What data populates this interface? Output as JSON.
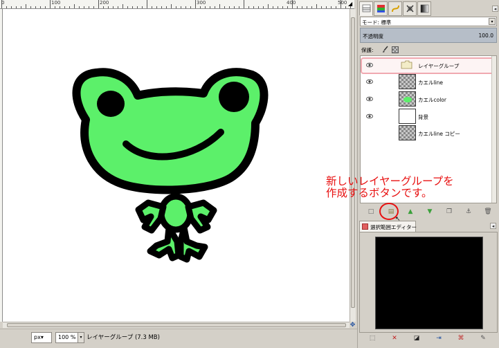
{
  "ruler": {
    "labels": [
      "0",
      "100",
      "200",
      "300",
      "400",
      "500"
    ],
    "corner_icon": "arrow-icon"
  },
  "status": {
    "unit": "px▾",
    "zoom": "100 %",
    "zoom_arrow": "▾",
    "text": "レイヤーグループ (7.3 MB)"
  },
  "dock": {
    "tabs": [
      "layers-icon",
      "channels-icon",
      "paths-icon",
      "undo-icon",
      "gradient-icon"
    ],
    "menu_glyph": "◂",
    "mode_label": "モード: 標準",
    "mode_arrow": "▾",
    "opacity_label": "不透明度",
    "opacity_value": "100.0",
    "lock_label": "保護:"
  },
  "layers": [
    {
      "name": "レイヤーグループ",
      "type": "group",
      "visible": true,
      "selected": true
    },
    {
      "name": "カエルline",
      "type": "checker",
      "visible": true,
      "selected": false
    },
    {
      "name": "カエルcolor",
      "type": "checker",
      "visible": true,
      "selected": false
    },
    {
      "name": "背景",
      "type": "white",
      "visible": true,
      "selected": false
    },
    {
      "name": "カエルline コピー",
      "type": "checker",
      "visible": false,
      "selected": false
    }
  ],
  "layer_buttons": [
    {
      "name": "new-layer-button",
      "glyph": "□"
    },
    {
      "name": "new-layer-group-button",
      "glyph": "▤"
    },
    {
      "name": "raise-layer-button",
      "glyph": "▲"
    },
    {
      "name": "lower-layer-button",
      "glyph": "▼"
    },
    {
      "name": "duplicate-layer-button",
      "glyph": "❐"
    },
    {
      "name": "anchor-layer-button",
      "glyph": "⚓"
    },
    {
      "name": "delete-layer-button",
      "glyph": "🗑"
    }
  ],
  "annotation": {
    "line1": "新しいレイヤーグループを",
    "line2": "作成するボタンです。",
    "color": "#e81010"
  },
  "selection_editor": {
    "title": "選択範囲エディター",
    "menu_glyph": "◂",
    "buttons": [
      {
        "name": "select-all-button",
        "glyph": "⬚"
      },
      {
        "name": "select-none-button",
        "glyph": "✕"
      },
      {
        "name": "invert-selection-button",
        "glyph": "◪"
      },
      {
        "name": "save-to-channel-button",
        "glyph": "⇥"
      },
      {
        "name": "to-path-button",
        "glyph": "⌘"
      },
      {
        "name": "stroke-selection-button",
        "glyph": "✎"
      }
    ]
  },
  "colors": {
    "frog_green": "#5cf06a",
    "frog_outline": "#000000",
    "annotation_red": "#e81010"
  }
}
